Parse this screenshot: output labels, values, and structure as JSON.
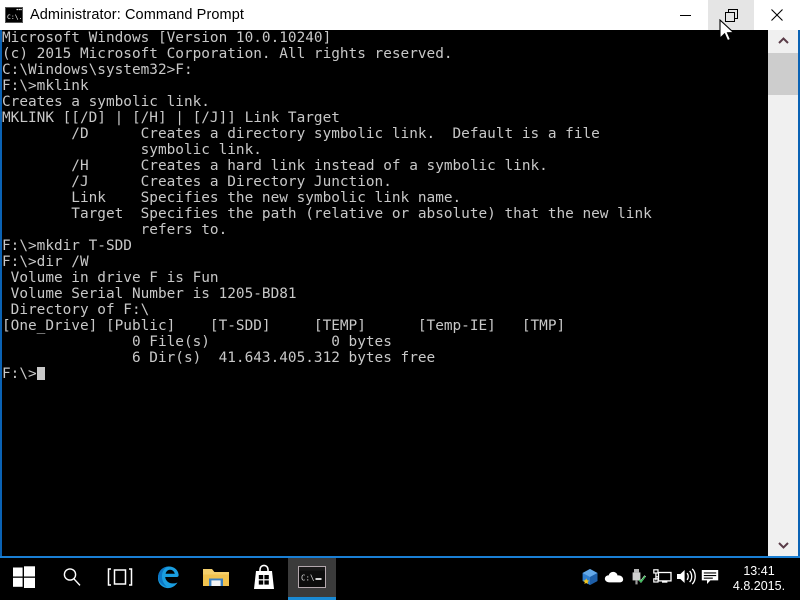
{
  "window": {
    "title": "Administrator: Command Prompt",
    "icon": "console-icon",
    "border_color": "#0a62b4",
    "titlebar_bg": "#ffffff",
    "controls": {
      "minimize_label": "─",
      "maximize_label": "❐",
      "close_label": "✕",
      "hovered": "maximize"
    }
  },
  "console": {
    "background": "#000000",
    "foreground": "#c8c8c8",
    "lines": [
      "Microsoft Windows [Version 10.0.10240]",
      "(c) 2015 Microsoft Corporation. All rights reserved.",
      "",
      "C:\\Windows\\system32>F:",
      "",
      "F:\\>mklink",
      "Creates a symbolic link.",
      "",
      "MKLINK [[/D] | [/H] | [/J]] Link Target",
      "",
      "        /D      Creates a directory symbolic link.  Default is a file",
      "                symbolic link.",
      "        /H      Creates a hard link instead of a symbolic link.",
      "        /J      Creates a Directory Junction.",
      "        Link    Specifies the new symbolic link name.",
      "        Target  Specifies the path (relative or absolute) that the new link",
      "                refers to.",
      "",
      "F:\\>mkdir T-SDD",
      "",
      "F:\\>dir /W",
      " Volume in drive F is Fun",
      " Volume Serial Number is 1205-BD81",
      "",
      " Directory of F:\\",
      "",
      "[One_Drive] [Public]    [T-SDD]     [TEMP]      [Temp-IE]   [TMP]",
      "               0 File(s)              0 bytes",
      "               6 Dir(s)  41.643.405.312 bytes free",
      "",
      "F:\\>"
    ],
    "prompt_cursor": "block"
  },
  "scrollbar": {
    "up_arrow": "⌃",
    "down_arrow": "⌄",
    "track_color": "#f0f0f0",
    "thumb_color": "#cdcdcd"
  },
  "taskbar": {
    "background": "#000000",
    "buttons": [
      {
        "name": "start",
        "icon": "windows-logo-icon",
        "active": false
      },
      {
        "name": "search",
        "icon": "search-icon",
        "active": false
      },
      {
        "name": "task-view",
        "icon": "task-view-icon",
        "active": false
      },
      {
        "name": "edge",
        "icon": "edge-browser-icon",
        "active": false
      },
      {
        "name": "file-explorer",
        "icon": "folder-icon",
        "active": false
      },
      {
        "name": "store",
        "icon": "store-bag-icon",
        "active": false
      },
      {
        "name": "command-prompt",
        "icon": "console-icon",
        "active": true
      }
    ],
    "tray": [
      {
        "name": "app",
        "icon": "blue-cube-star-icon"
      },
      {
        "name": "onedrive",
        "icon": "cloud-icon"
      },
      {
        "name": "safely-remove-hardware",
        "icon": "usb-check-icon"
      },
      {
        "name": "network",
        "icon": "network-monitor-icon"
      },
      {
        "name": "volume",
        "icon": "speaker-icon"
      },
      {
        "name": "action-center",
        "icon": "speech-bubble-icon"
      }
    ],
    "clock": {
      "time": "13:41",
      "date": "4.8.2015."
    },
    "accent_color": "#1a8ad4"
  }
}
